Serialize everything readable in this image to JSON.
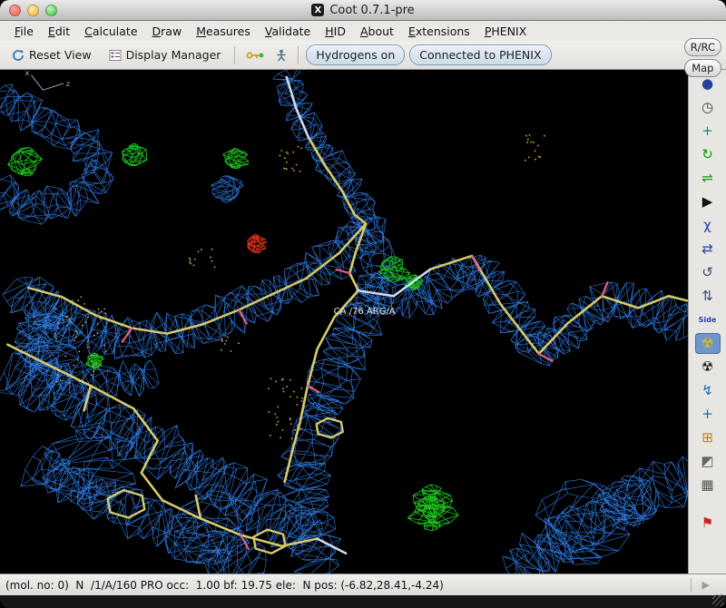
{
  "window": {
    "title": "Coot 0.7.1-pre"
  },
  "menu": {
    "items": [
      "File",
      "Edit",
      "Calculate",
      "Draw",
      "Measures",
      "Validate",
      "HID",
      "About",
      "Extensions",
      "PHENIX"
    ]
  },
  "toolbar": {
    "reset_view": "Reset View",
    "display_manager": "Display Manager",
    "hydrogens_toggle": "Hydrogens on",
    "phenix_toggle": "Connected to PHENIX"
  },
  "side_buttons": {
    "rrc": "R/RC",
    "map": "Map"
  },
  "right_toolbar": {
    "icons": [
      {
        "name": "display-sphere-icon",
        "glyph": "●",
        "color": "#24409a"
      },
      {
        "name": "clock-icon",
        "glyph": "◷",
        "color": "#444444"
      },
      {
        "name": "move-axes-icon",
        "glyph": "+",
        "color": "#0a8f8f"
      },
      {
        "name": "rotate-green-icon",
        "glyph": "↻",
        "color": "#0b9a0b"
      },
      {
        "name": "torsion-green-icon",
        "glyph": "⇌",
        "color": "#0b9a0b"
      },
      {
        "name": "pointer-icon",
        "glyph": "▶",
        "color": "#111111"
      },
      {
        "name": "chi-angles-icon",
        "glyph": "χ",
        "color": "#2a3fae"
      },
      {
        "name": "flip-icon",
        "glyph": "⇄",
        "color": "#2a3fae"
      },
      {
        "name": "rotate-translate-icon",
        "glyph": "↺",
        "color": "#3a4c7a"
      },
      {
        "name": "rigid-body-icon",
        "glyph": "⇅",
        "color": "#3a4c7a"
      },
      {
        "name": "side-chain-icon",
        "glyph": "Side",
        "color": "#2a3fae",
        "small": true
      },
      {
        "name": "refine-icon",
        "glyph": "☢",
        "color": "#e3c100",
        "active": true
      },
      {
        "name": "regularize-icon",
        "glyph": "☢",
        "color": "#222222"
      },
      {
        "name": "pepflip-icon",
        "glyph": "↯",
        "color": "#1b6fae"
      },
      {
        "name": "add-atom-icon",
        "glyph": "+",
        "color": "#1b6fae"
      },
      {
        "name": "add-water-icon",
        "glyph": "⊞",
        "color": "#b8860b"
      },
      {
        "name": "mutate-icon",
        "glyph": "◩",
        "color": "#666666"
      },
      {
        "name": "trash-icon",
        "glyph": "▦",
        "color": "#555555"
      },
      {
        "name": "flag-icon",
        "glyph": "⚑",
        "color": "#cc2222",
        "flag": true
      }
    ]
  },
  "canvas": {
    "atom_label": "CA /76 ARG/A",
    "axis_labels": [
      "x",
      "z"
    ]
  },
  "statusbar": {
    "text": "(mol. no: 0)  N  /1/A/160 PRO occ:  1.00 bf: 19.75 ele:  N pos: (-6.82,28.41,-4.24)",
    "spinner_glyph": "▶"
  },
  "colors": {
    "mesh_blue": "#2e7ce6",
    "mesh_green": "#1fca1f",
    "mesh_red": "#e0321e",
    "stick_yellow": "#d6ca6e",
    "stick_light": "#ccdcee",
    "stick_pink": "#e0607e",
    "dots": "#c9a23f"
  }
}
